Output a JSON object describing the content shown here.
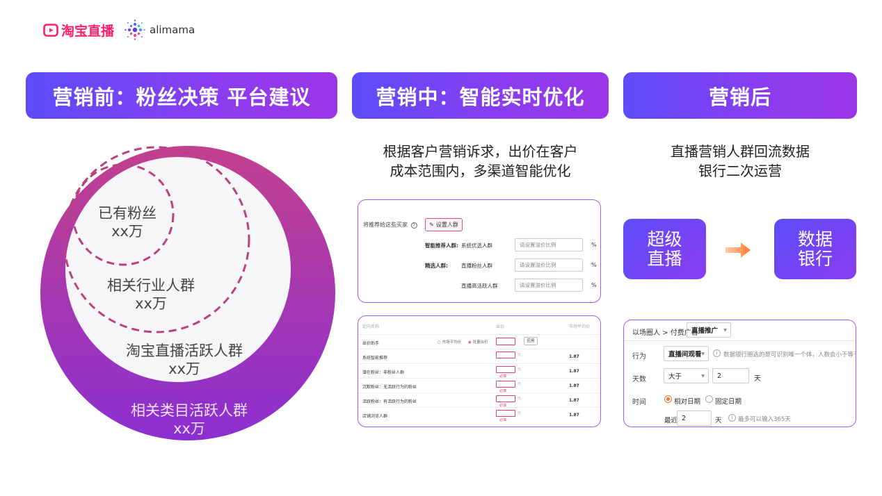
{
  "logos": {
    "taobao_text": "淘宝直播",
    "alimama_text": "alimama"
  },
  "headers": {
    "h1": "营销前：粉丝决策 平台建议",
    "h2": "营销中：智能实时优化",
    "h3": "营销后"
  },
  "desc2": {
    "line1": "根据客户营销诉求，出价在客户",
    "line2": "成本范围内，多渠道智能优化"
  },
  "desc3": {
    "line1": "直播营销人群回流数据",
    "line2": "银行二次运营"
  },
  "circles": {
    "c1": {
      "name": "已有粉丝",
      "value": "xx万"
    },
    "c2": {
      "name": "相关行业人群",
      "value": "xx万"
    },
    "c3": {
      "name": "淘宝直播活跃人群",
      "value": "xx万"
    },
    "c4": {
      "name": "相关类目活跃人群",
      "value": "xx万"
    }
  },
  "panel_a": {
    "question": "将推荐给这些买家",
    "button": "设置人群",
    "rows": [
      {
        "label": "智能推荐人群:",
        "sub": "系统优选人群",
        "placeholder": "请设置溢价比例",
        "unit": "%"
      },
      {
        "label": "精选人群:",
        "sub": "直播粉丝人群",
        "placeholder": "请设置溢价比例",
        "unit": "%"
      },
      {
        "label": "",
        "sub": "直播高活跃人群",
        "placeholder": "请设置溢价比例",
        "unit": "%"
      }
    ]
  },
  "panel_b": {
    "col1": "定向名称",
    "col2": "出价",
    "col3": "市场平均价",
    "helper": {
      "label": "出价助手",
      "opt1": "市场平均价",
      "opt2": "批量出价",
      "apply": "应用"
    },
    "rows": [
      {
        "name": "系统智能推荐",
        "value": "1.87"
      },
      {
        "name": "潜在粉丝：非粉丝人群",
        "value": "1.87"
      },
      {
        "name": "沉默粉丝：无活跃行为的粉丝",
        "value": "1.87"
      },
      {
        "name": "活跃粉丝：有活跃行为的粉丝",
        "value": "1.87"
      },
      {
        "name": "店铺浏览人群",
        "value": "1.87"
      }
    ],
    "unit": "元",
    "required": "必填"
  },
  "panel_c": {
    "breadcrumb": "以场圈人 > 付费广告",
    "breadcrumb_select": "直播推广",
    "behavior_label": "行为",
    "behavior_value": "直播间观看",
    "behavior_note": "数据银行圈选的是可识别唯一个体，人数会小于等于UV",
    "days_label": "天数",
    "days_op": "大于",
    "days_value": "2",
    "days_unit": "天",
    "time_label": "时间",
    "time_opt1": "相对日期",
    "time_opt2": "固定日期",
    "recent_label": "最近",
    "recent_value": "2",
    "recent_unit": "天",
    "recent_note": "最多可以输入365天"
  },
  "flow": {
    "left": "超级直播",
    "left_l1": "超级",
    "left_l2": "直播",
    "right_l1": "数据",
    "right_l2": "银行"
  },
  "colors": {
    "accent_purple": "#8a3df0",
    "accent_blue": "#5c4cf8",
    "taobao_red": "#ff1e6e",
    "arrow_orange": "#ff7a2a"
  }
}
